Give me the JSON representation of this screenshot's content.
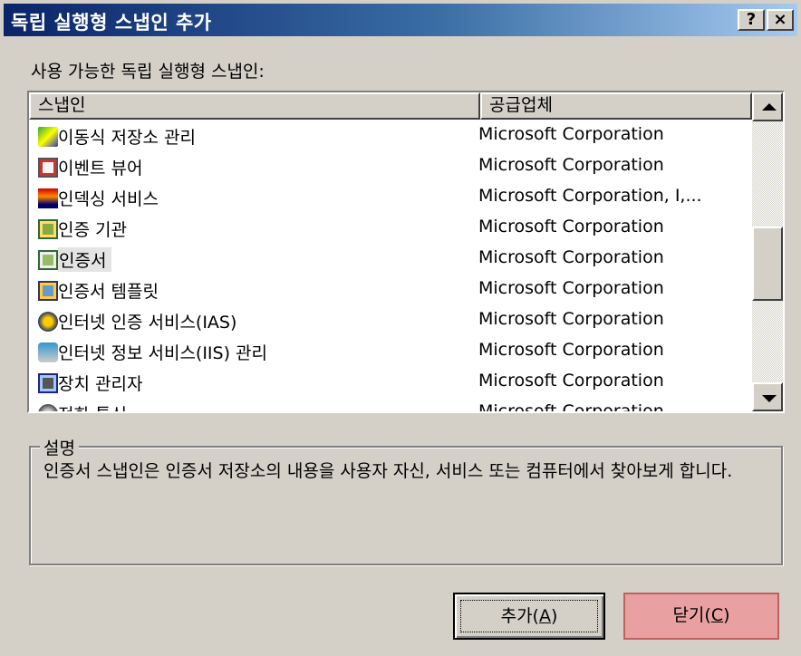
{
  "window": {
    "title": "독립 실행형 스냅인 추가",
    "help_label": "?",
    "close_label": "×"
  },
  "available_label": "사용 가능한 독립 실행형 스냅인:",
  "list": {
    "columns": [
      "스냅인",
      "공급업체"
    ],
    "rows": [
      {
        "name": "이동식 저장소 관리",
        "vendor": "Microsoft Corporation",
        "icon": "removable-storage-icon"
      },
      {
        "name": "이벤트 뷰어",
        "vendor": "Microsoft Corporation",
        "icon": "event-viewer-icon"
      },
      {
        "name": "인덱싱 서비스",
        "vendor": "Microsoft Corporation, I,...",
        "icon": "indexing-service-icon"
      },
      {
        "name": "인증 기관",
        "vendor": "Microsoft Corporation",
        "icon": "certificate-authority-icon"
      },
      {
        "name": "인증서",
        "vendor": "Microsoft Corporation",
        "icon": "certificates-icon",
        "selected": true
      },
      {
        "name": "인증서 템플릿",
        "vendor": "Microsoft Corporation",
        "icon": "certificate-templates-icon"
      },
      {
        "name": "인터넷 인증 서비스(IAS)",
        "vendor": "Microsoft Corporation",
        "icon": "ias-icon"
      },
      {
        "name": "인터넷 정보 서비스(IIS) 관리",
        "vendor": "Microsoft Corporation",
        "icon": "iis-icon"
      },
      {
        "name": "장치 관리자",
        "vendor": "Microsoft Corporation",
        "icon": "device-manager-icon"
      },
      {
        "name": "전화 통신",
        "vendor": "Microsoft Corporation",
        "icon": "telephony-icon"
      }
    ]
  },
  "description": {
    "label": "설명",
    "text": "인증서 스냅인은 인증서 저장소의 내용을 사용자 자신, 서비스 또는 컴퓨터에서 찾아보게 합니다."
  },
  "buttons": {
    "add": {
      "label": "추가(",
      "mnemonic": "A",
      "suffix": ")"
    },
    "close": {
      "label": "닫기(",
      "mnemonic": "C",
      "suffix": ")"
    }
  }
}
